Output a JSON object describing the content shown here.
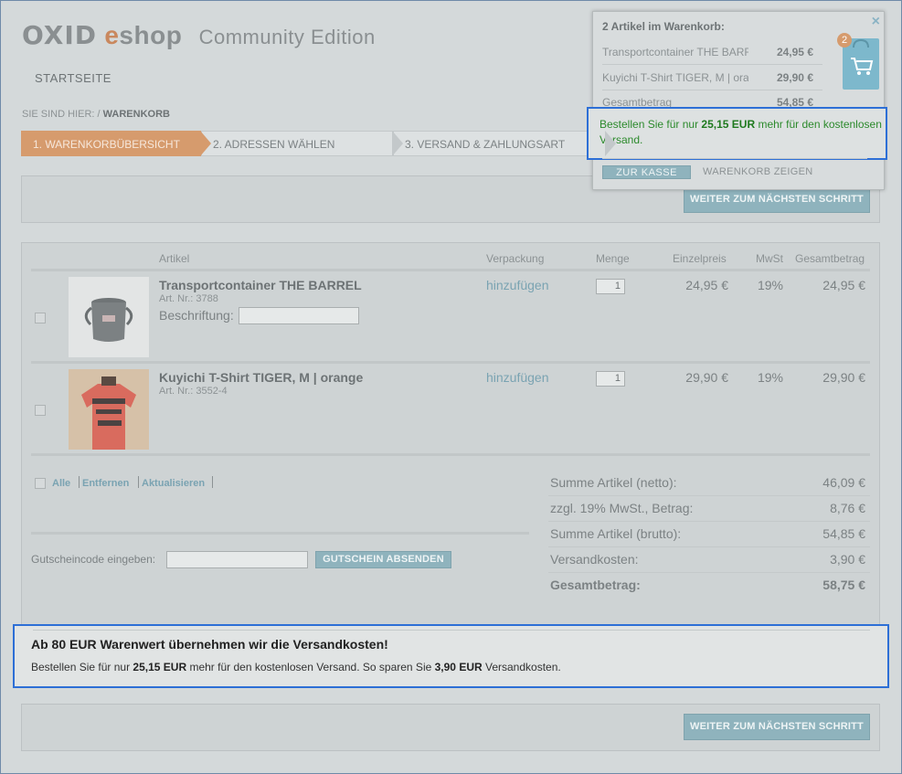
{
  "header": {
    "logo_oxid": "OXID",
    "logo_e": "e",
    "logo_shop": "shop",
    "logo_edition": "Community Edition",
    "nav_start": "STARTSEITE",
    "breadcrumb_prefix": "SIE SIND HIER: /",
    "breadcrumb_current": "WARENKORB"
  },
  "steps": [
    {
      "label": "1. WARENKORBÜBERSICHT"
    },
    {
      "label": "2. ADRESSEN WÄHLEN"
    },
    {
      "label": "3. VERSAND & ZAHLUNGSART"
    }
  ],
  "buttons": {
    "next_step": "WEITER ZUM NÄCHSTEN SCHRITT",
    "voucher_submit": "GUTSCHEIN ABSENDEN"
  },
  "table": {
    "headers": {
      "article": "Artikel",
      "packaging": "Verpackung",
      "quantity": "Menge",
      "unit_price": "Einzelpreis",
      "vat": "MwSt",
      "total": "Gesamtbetrag"
    },
    "items": [
      {
        "name": "Transportcontainer THE BARREL",
        "artno": "Art. Nr.: 3788",
        "label_field": "Beschriftung:",
        "packaging": "hinzufügen",
        "qty": "1",
        "unit_price": "24,95 €",
        "vat": "19%",
        "total": "24,95 €"
      },
      {
        "name": "Kuyichi T-Shirt TIGER, M | orange",
        "artno": "Art. Nr.: 3552-4",
        "packaging": "hinzufügen",
        "qty": "1",
        "unit_price": "29,90 €",
        "vat": "19%",
        "total": "29,90 €"
      }
    ],
    "actions": {
      "all": "Alle",
      "remove": "Entfernen",
      "update": "Aktualisieren"
    }
  },
  "voucher": {
    "label": "Gutscheincode eingeben:",
    "value": ""
  },
  "summary": [
    {
      "label": "Summe Artikel (netto):",
      "value": "46,09 €"
    },
    {
      "label": "zzgl. 19% MwSt., Betrag:",
      "value": "8,76 €"
    },
    {
      "label": "Summe Artikel (brutto):",
      "value": "54,85 €"
    },
    {
      "label": "Versandkosten:",
      "value": "3,90 €"
    },
    {
      "label": "Gesamtbetrag:",
      "value": "58,75 €"
    }
  ],
  "shipping_notice": {
    "heading": "Ab 80 EUR Warenwert übernehmen wir die Versandkosten!",
    "text_1": "Bestellen Sie für nur",
    "amount": "25,15 EUR",
    "text_2": "mehr für den kostenlosen Versand. So sparen Sie",
    "saving": "3,90 EUR",
    "text_3": "Versandkosten."
  },
  "minibasket": {
    "title": "2 Artikel im Warenkorb:",
    "close": "×",
    "items": [
      {
        "name": "Transportcontainer THE BARREL",
        "price": "24,95 €"
      },
      {
        "name": "Kuyichi T-Shirt TIGER, M | orange",
        "price": "29,90 €"
      }
    ],
    "total_label": "Gesamtbetrag",
    "total_value": "54,85 €",
    "free_text_1": "Bestellen Sie für nur",
    "free_amount": "25,15 EUR",
    "free_text_2": "mehr für den kostenlosen Versand.",
    "checkout": "ZUR KASSE",
    "show_cart": "WARENKORB ZEIGEN",
    "badge_count": "2"
  },
  "icons": {
    "cart": "shopping-bag-icon",
    "close": "close-icon"
  },
  "colors": {
    "accent_step": "#d69b6d",
    "button_blue": "#8fb3bd",
    "link_blue": "#7aa3b2",
    "highlight_border": "#2d6fd6",
    "free_shipping_green": "#2c8a2c"
  }
}
